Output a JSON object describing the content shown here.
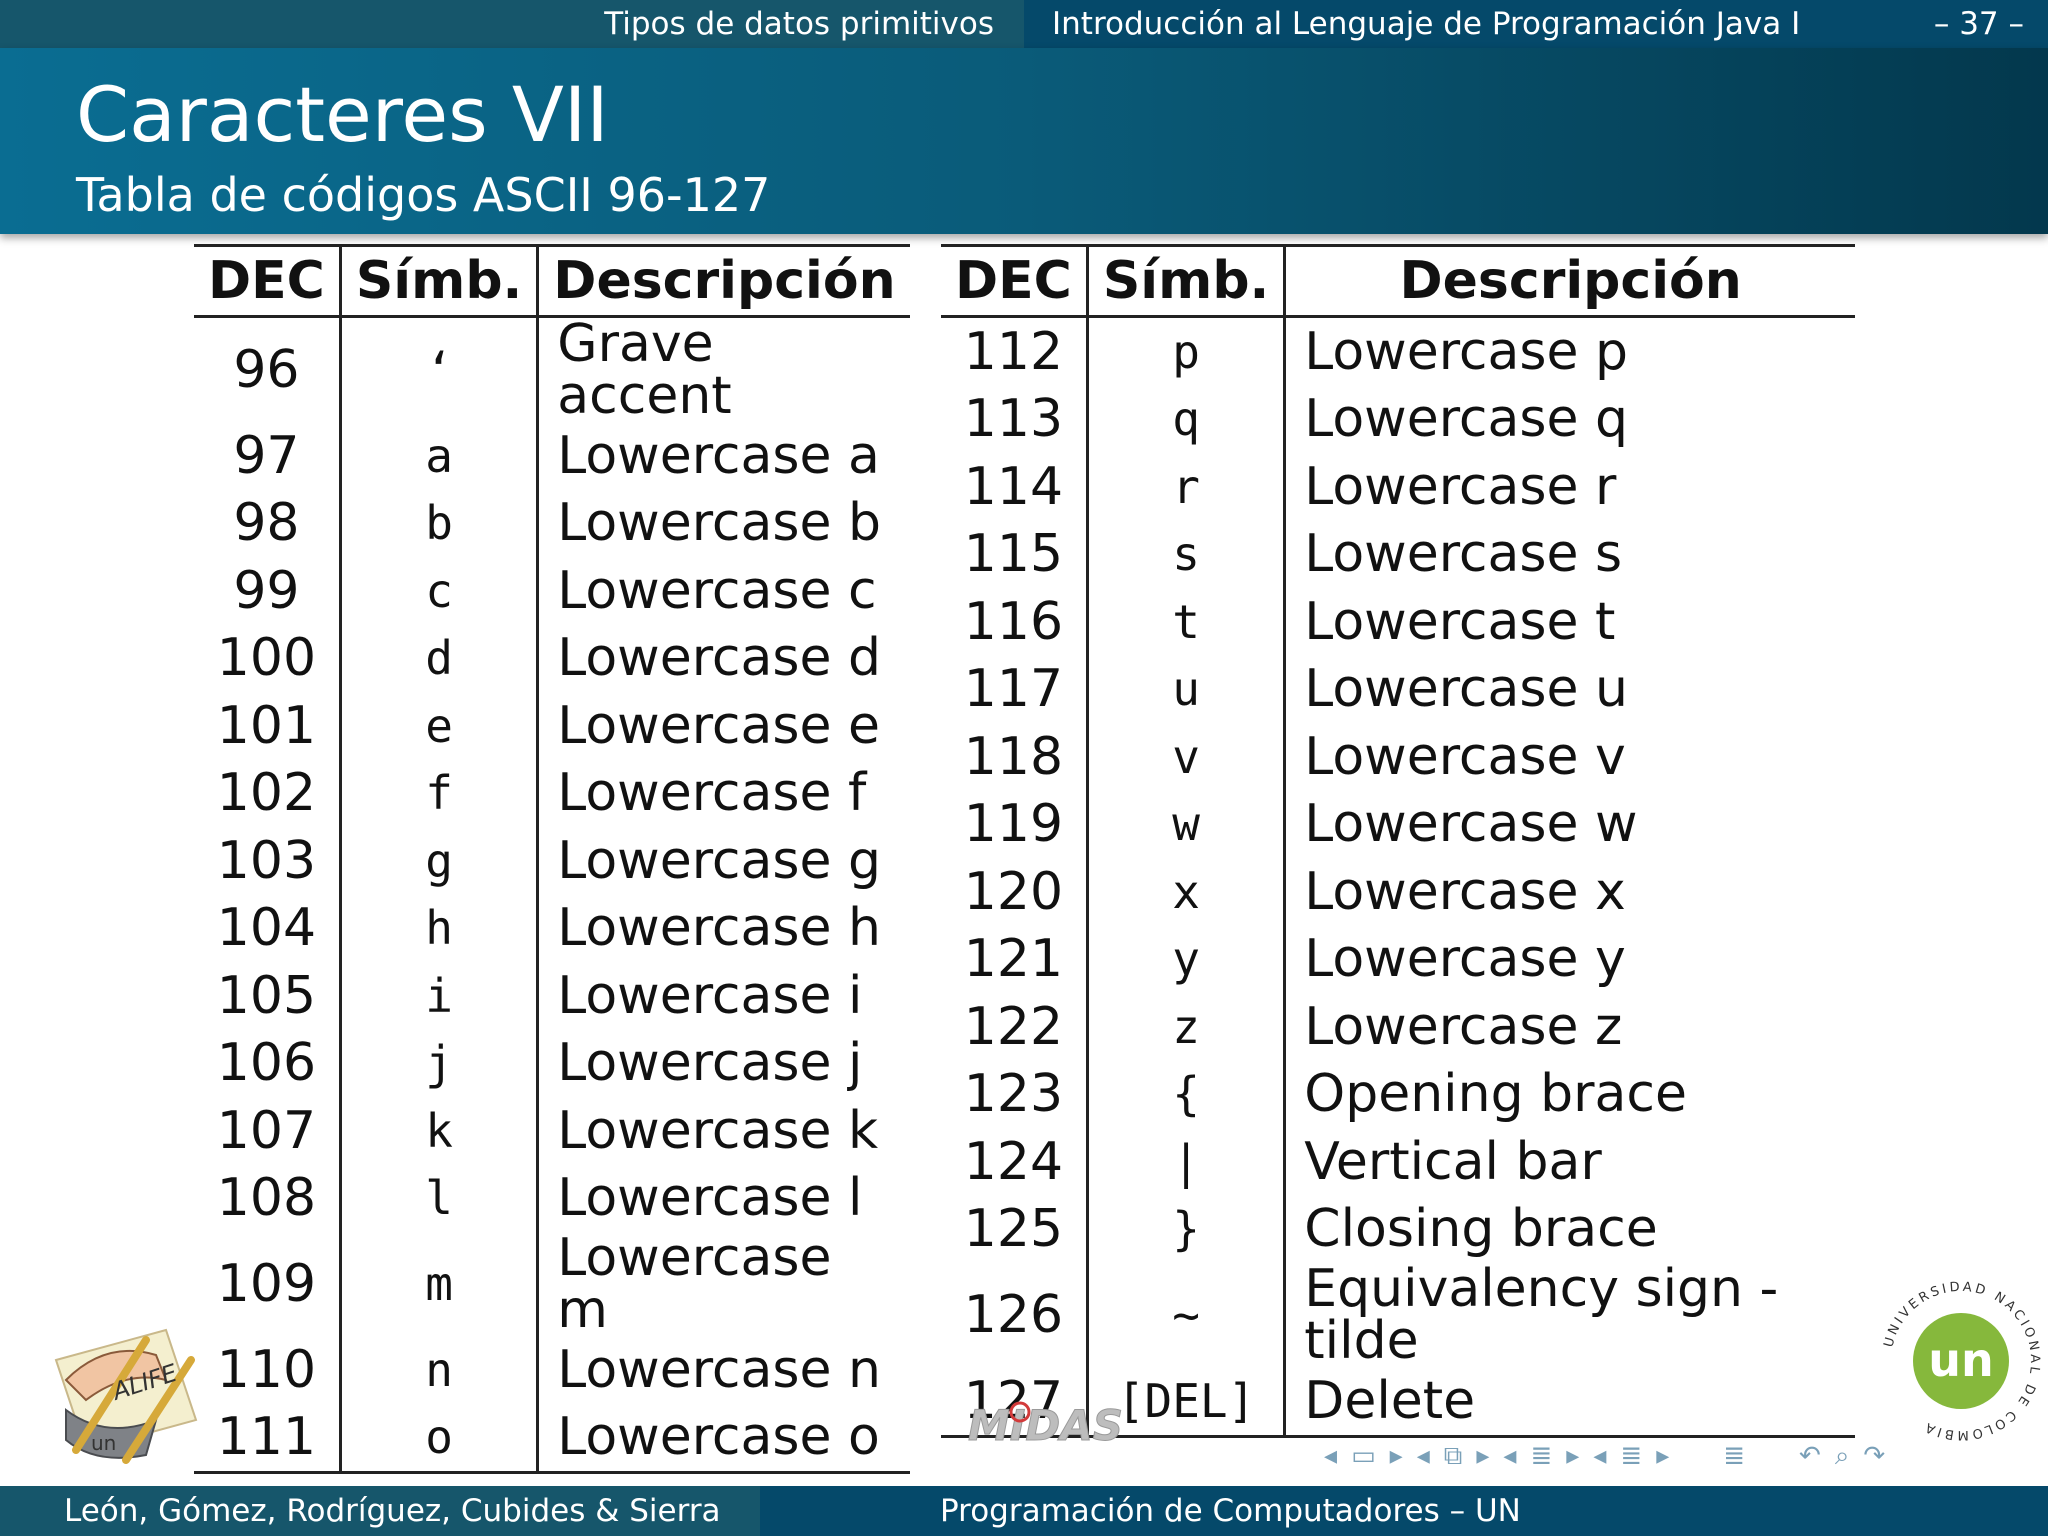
{
  "topbar": {
    "section": "Tipos de datos primitivos",
    "document": "Introducción al Lenguaje de Programación Java I",
    "page": "– 37 –"
  },
  "header": {
    "title": "Caracteres VII",
    "subtitle": "Tabla de códigos ASCII 96-127"
  },
  "table_left": {
    "headers": [
      "DEC",
      "Símb.",
      "Descripción"
    ],
    "rows": [
      [
        "96",
        "‘",
        "Grave accent"
      ],
      [
        "97",
        "a",
        "Lowercase a"
      ],
      [
        "98",
        "b",
        "Lowercase b"
      ],
      [
        "99",
        "c",
        "Lowercase c"
      ],
      [
        "100",
        "d",
        "Lowercase d"
      ],
      [
        "101",
        "e",
        "Lowercase e"
      ],
      [
        "102",
        "f",
        "Lowercase f"
      ],
      [
        "103",
        "g",
        "Lowercase g"
      ],
      [
        "104",
        "h",
        "Lowercase h"
      ],
      [
        "105",
        "i",
        "Lowercase i"
      ],
      [
        "106",
        "j",
        "Lowercase j"
      ],
      [
        "107",
        "k",
        "Lowercase k"
      ],
      [
        "108",
        "l",
        "Lowercase l"
      ],
      [
        "109",
        "m",
        "Lowercase m"
      ],
      [
        "110",
        "n",
        "Lowercase n"
      ],
      [
        "111",
        "o",
        "Lowercase o"
      ]
    ]
  },
  "table_right": {
    "headers": [
      "DEC",
      "Símb.",
      "Descripción"
    ],
    "rows": [
      [
        "112",
        "p",
        "Lowercase p"
      ],
      [
        "113",
        "q",
        "Lowercase q"
      ],
      [
        "114",
        "r",
        "Lowercase r"
      ],
      [
        "115",
        "s",
        "Lowercase s"
      ],
      [
        "116",
        "t",
        "Lowercase t"
      ],
      [
        "117",
        "u",
        "Lowercase u"
      ],
      [
        "118",
        "v",
        "Lowercase v"
      ],
      [
        "119",
        "w",
        "Lowercase w"
      ],
      [
        "120",
        "x",
        "Lowercase x"
      ],
      [
        "121",
        "y",
        "Lowercase y"
      ],
      [
        "122",
        "z",
        "Lowercase z"
      ],
      [
        "123",
        "{",
        "Opening brace"
      ],
      [
        "124",
        "|",
        "Vertical bar"
      ],
      [
        "125",
        "}",
        "Closing brace"
      ],
      [
        "126",
        "~",
        "Equivalency sign - tilde"
      ],
      [
        "127",
        "[DEL]",
        "Delete"
      ]
    ]
  },
  "footer": {
    "authors": "León, Gómez, Rodríguez, Cubides & Sierra",
    "course": "Programación de Computadores – UN"
  },
  "logos": {
    "left": "ALIFE",
    "left_small": "un",
    "middle": "MIDAS",
    "right_ring": "UNIVERSIDAD NACIONAL DE COLOMBIA",
    "right_center": "un"
  },
  "nav_icons": [
    "nav-prev-frame-icon",
    "nav-frame-icon",
    "nav-next-frame-icon",
    "nav-prev-subsection-icon",
    "nav-subsection-icon",
    "nav-next-subsection-icon",
    "nav-prev-section-icon",
    "nav-section-icon",
    "nav-next-section-icon",
    "nav-prev-doc-icon",
    "nav-doc-icon",
    "nav-next-doc-icon",
    "nav-toc-icon",
    "nav-back-icon",
    "nav-search-icon",
    "nav-forward-icon"
  ],
  "colors": {
    "header_start": "#0a6d92",
    "header_end": "#03384d",
    "bar_light": "#16566b",
    "bar_dark": "#05496a",
    "un_green": "#86b83c"
  }
}
